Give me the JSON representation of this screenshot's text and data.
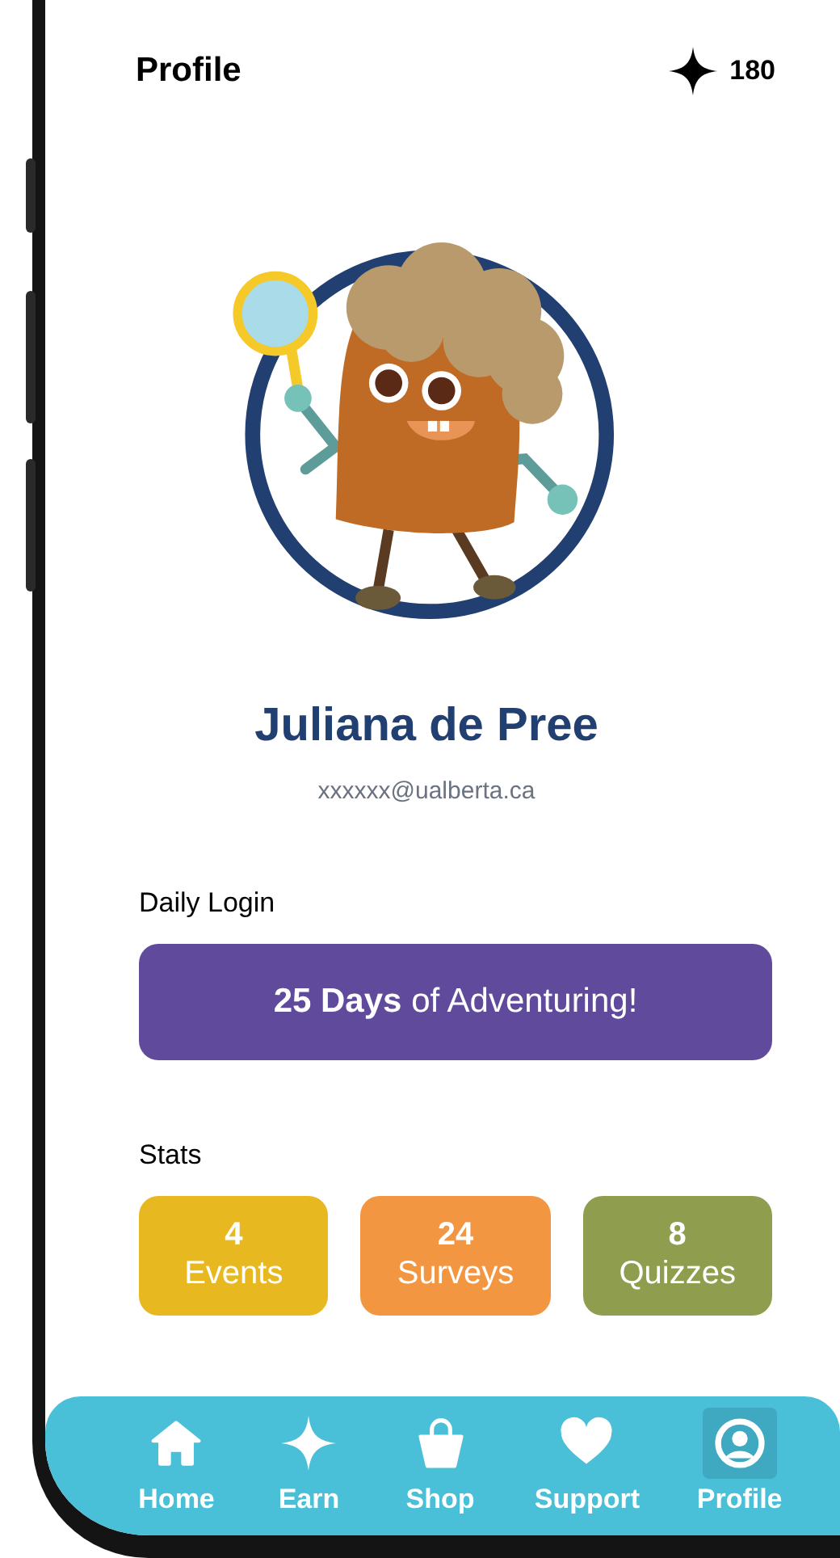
{
  "header": {
    "title": "Profile",
    "points": "180"
  },
  "user": {
    "name": "Juliana de Pree",
    "email": "xxxxxx@ualberta.ca"
  },
  "daily_login": {
    "label": "Daily Login",
    "message": "**25 Days** of Adventuring!"
  },
  "stats": {
    "label": "Stats",
    "items": [
      {
        "value": "4",
        "label": "Events",
        "color": "#e8b820"
      },
      {
        "value": "24",
        "label": "Surveys",
        "color": "#f39642"
      },
      {
        "value": "8",
        "label": "Quizzes",
        "color": "#8f9e4e"
      }
    ]
  },
  "nav": [
    {
      "kind": "home",
      "label": "Home",
      "selected": false
    },
    {
      "kind": "earn",
      "label": "Earn",
      "selected": false
    },
    {
      "kind": "shop",
      "label": "Shop",
      "selected": false
    },
    {
      "kind": "support",
      "label": "Support",
      "selected": false
    },
    {
      "kind": "profile",
      "label": "Profile",
      "selected": true
    }
  ]
}
